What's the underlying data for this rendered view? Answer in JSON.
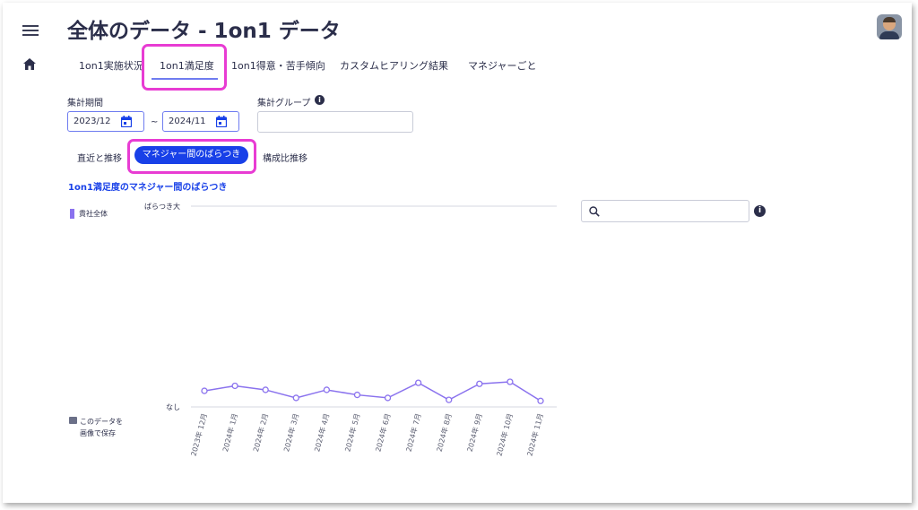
{
  "header": {
    "title": "全体のデータ - 1on1 データ"
  },
  "tabs": [
    {
      "label": "1on1実施状況"
    },
    {
      "label": "1on1満足度"
    },
    {
      "label": "1on1得意・苦手傾向"
    },
    {
      "label": "カスタムヒアリング結果"
    },
    {
      "label": "マネジャーごと"
    }
  ],
  "active_tab": "1on1満足度",
  "filters": {
    "period_label": "集計期間",
    "start": "2023/12",
    "separator": "~",
    "end": "2024/11",
    "group_label": "集計グループ",
    "group_value": ""
  },
  "segments": {
    "recent": "直近と推移",
    "variance": "マネジャー間のばらつき",
    "composition": "構成比推移"
  },
  "section_title": "1on1満足度のマネジャー間のばらつき",
  "legend": {
    "label": "貴社全体",
    "color": "#8a72ee"
  },
  "search": {
    "placeholder": ""
  },
  "save": {
    "line1": "このデータを",
    "line2": "画像で保存"
  },
  "colors": {
    "accent": "#1840e8",
    "highlight": "#e83cd3",
    "series": "#8a72ee"
  },
  "chart_data": {
    "type": "line",
    "ylabel_top": "ばらつき大",
    "ylabel_bottom": "なし",
    "x": [
      "2023年 12月",
      "2024年 1月",
      "2024年 2月",
      "2024年 3月",
      "2024年 4月",
      "2024年 5月",
      "2024年 6月",
      "2024年 7月",
      "2024年 8月",
      "2024年 9月",
      "2024年 10月",
      "2024年 11月"
    ],
    "series": [
      {
        "name": "貴社全体",
        "values": [
          0.08,
          0.105,
          0.085,
          0.045,
          0.085,
          0.06,
          0.045,
          0.12,
          0.035,
          0.115,
          0.125,
          0.03
        ]
      }
    ],
    "ylim": [
      0,
      1
    ],
    "grid": true
  }
}
